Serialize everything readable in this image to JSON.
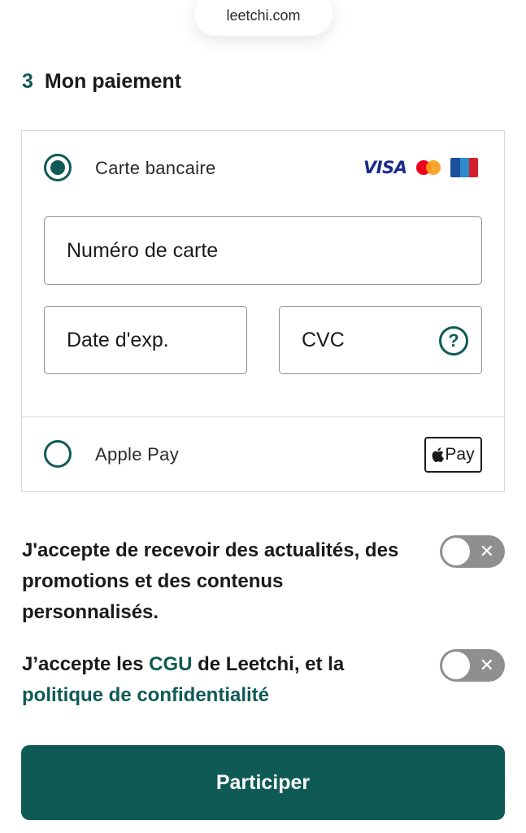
{
  "browser": {
    "url": "leetchi.com"
  },
  "section": {
    "number": "3",
    "title": "Mon paiement"
  },
  "payment": {
    "card_option_label": "Carte bancaire",
    "brands": {
      "visa": "VISA"
    },
    "card_number_placeholder": "Numéro de carte",
    "expiry_placeholder": "Date d'exp.",
    "cvc_placeholder": "CVC",
    "help_symbol": "?",
    "apple_pay_option_label": "Apple Pay",
    "apple_pay_badge": "Pay",
    "selected": "card"
  },
  "consents": {
    "marketing": {
      "text": "J'accepte de recevoir des actualités, des promotions et des contenus personnalisés.",
      "enabled": false
    },
    "terms": {
      "text_before": "J’accepte les ",
      "cgu_link": "CGU",
      "text_middle": " de Leetchi, et la ",
      "privacy_link": "politique de confidentialité",
      "enabled": false
    }
  },
  "cta": {
    "label": "Participer"
  },
  "colors": {
    "brand": "#0f5a55",
    "toggle_off": "#8f8f8f",
    "border": "#d8d8d8"
  }
}
